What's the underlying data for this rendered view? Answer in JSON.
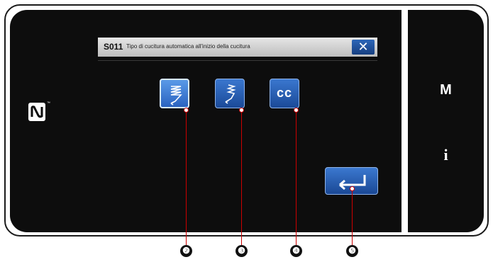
{
  "dialog": {
    "code": "S011",
    "title": "Tipo di cucitura automatica all'inizio della cucitura",
    "close_symbol": "✕"
  },
  "options": [
    {
      "icon": "backtack-stitch-icon",
      "selected": true
    },
    {
      "icon": "single-backtack-stitch-icon",
      "selected": false
    },
    {
      "icon": "cc-text-icon",
      "label": "cc",
      "selected": false
    }
  ],
  "side_panel": {
    "m_label": "M",
    "info_label": "i"
  },
  "nfc": {
    "icon": "nfc-icon",
    "tm": "™"
  },
  "enter": {
    "icon": "enter-arrow-icon"
  },
  "callouts": [
    "❷",
    "❸",
    "❹",
    "❺"
  ],
  "colors": {
    "button_blue": "#2a63c0",
    "screen": "#0d0d0d",
    "callout_red": "#cc0000"
  }
}
